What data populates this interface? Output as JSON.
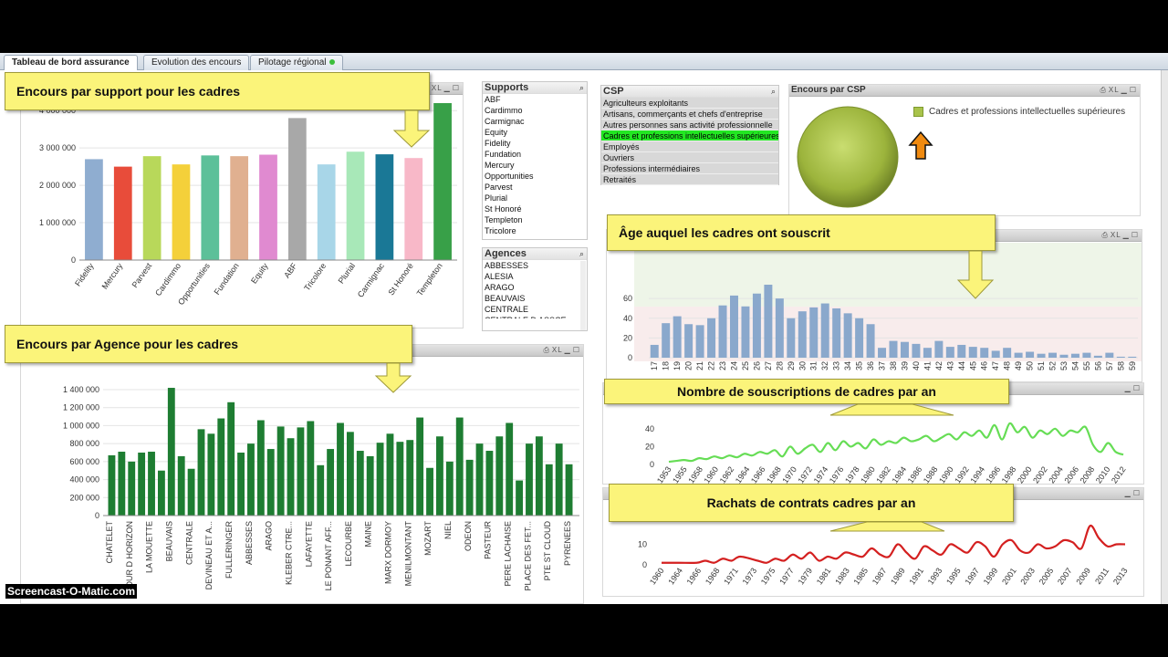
{
  "tabs": [
    {
      "label": "Tableau de bord assurance",
      "active": true
    },
    {
      "label": "Evolution des encours",
      "active": false
    },
    {
      "label": "Pilotage régional",
      "active": false
    }
  ],
  "callouts": {
    "support": "Encours par support pour les cadres",
    "agence": "Encours par Agence pour les cadres",
    "age": "Âge auquel les cadres ont souscrit",
    "souscriptions": "Nombre de souscriptions de cadres par an",
    "rachats": "Rachats de contrats cadres par an"
  },
  "panel_icons": {
    "xl": "XL"
  },
  "supports_list": {
    "title": "Supports",
    "items": [
      "ABF",
      "Cardimmo",
      "Carmignac",
      "Equity",
      "Fidelity",
      "Fundation",
      "Mercury",
      "Opportunities",
      "Parvest",
      "Plurial",
      "St Honoré",
      "Templeton",
      "Tricolore"
    ]
  },
  "agences_list": {
    "title": "Agences",
    "items": [
      "ABBESSES",
      "ALESIA",
      "ARAGO",
      "BEAUVAIS",
      "CENTRALE",
      "CENTRALE D ASSCE"
    ]
  },
  "csp_list": {
    "title": "CSP",
    "items": [
      "Agriculteurs exploitants",
      "Artisans, commerçants et chefs d'entreprise",
      "Autres personnes sans activité professionnelle",
      "Cadres et professions intellectuelles supérieures",
      "Employés",
      "Ouvriers",
      "Professions intermédiaires",
      "Retraités"
    ],
    "selected_index": 3
  },
  "encours_csp": {
    "title": "Encours par CSP",
    "legend": "Cadres et professions intellectuelles supérieures"
  },
  "watermark": "Screencast-O-Matic.com",
  "charts": {
    "support": {
      "type": "bar",
      "categories": [
        "Fidelity",
        "Mercury",
        "Parvest",
        "Cardimmo",
        "Opportunities",
        "Fundation",
        "Equity",
        "ABF",
        "Tricolore",
        "Plurial",
        "Carmignac",
        "St Honoré",
        "Templeton"
      ],
      "values": [
        2700000,
        2500000,
        2780000,
        2560000,
        2800000,
        2780000,
        2820000,
        3800000,
        2560000,
        2900000,
        2830000,
        2730000,
        4200000
      ],
      "colors": [
        "#8fadd0",
        "#e84c3a",
        "#b8d85a",
        "#f4d03a",
        "#5cc099",
        "#e0b090",
        "#e08ad0",
        "#a8a8a8",
        "#a8d6e8",
        "#a8e8b8",
        "#1a7896",
        "#f8b8c8",
        "#38a048"
      ],
      "ylim": [
        0,
        4200000
      ],
      "ticks": [
        0,
        1000000,
        2000000,
        3000000,
        4000000
      ],
      "tick_labels": [
        "0",
        "1 000 000",
        "2 000 000",
        "3 000 000",
        "4 000 000"
      ]
    },
    "agence": {
      "type": "bar",
      "color": "#1e7d32",
      "values": [
        670000,
        710000,
        600000,
        700000,
        710000,
        500000,
        1420000,
        660000,
        520000,
        960000,
        910000,
        1080000,
        1260000,
        700000,
        800000,
        1060000,
        740000,
        990000,
        860000,
        980000,
        1050000,
        560000,
        740000,
        1030000,
        930000,
        720000,
        660000,
        810000,
        910000,
        820000,
        840000,
        1090000,
        530000,
        880000,
        600000,
        1090000,
        620000,
        800000,
        720000,
        880000,
        1030000,
        390000,
        800000,
        880000,
        570000,
        800000,
        570000
      ],
      "labels": [
        "CHATELET",
        "COUR D HORIZON",
        "LA MOUETTE",
        "BEAUVAIS",
        "CENTRALE",
        "DEVINEAU ET A...",
        "FULLERINGER",
        "ABBESSES",
        "ARAGO",
        "KLEBER CTRE...",
        "LAFAYETTE",
        "LE PONANT AFF...",
        "LECOURBE",
        "MAINE",
        "MARX DORMOY",
        "MENILMONTANT",
        "MOZART",
        "NIEL",
        "ODEON",
        "PASTEUR",
        "PERE LACHAISE",
        "PLACE DES FET...",
        "PTE ST CLOUD",
        "PYRENEES"
      ],
      "ylim": [
        0,
        1400000
      ],
      "ticks": [
        0,
        200000,
        400000,
        600000,
        800000,
        1000000,
        1200000,
        1400000
      ],
      "tick_labels": [
        "0",
        "200 000",
        "400 000",
        "600 000",
        "800 000",
        "1 000 000",
        "1 200 000",
        "1 400 000"
      ]
    },
    "age": {
      "type": "bar",
      "color": "#8aa8cc",
      "categories": [
        "17",
        "18",
        "19",
        "20",
        "21",
        "22",
        "23",
        "24",
        "25",
        "26",
        "27",
        "28",
        "29",
        "30",
        "31",
        "32",
        "33",
        "34",
        "35",
        "36",
        "37",
        "38",
        "39",
        "40",
        "41",
        "42",
        "43",
        "44",
        "45",
        "46",
        "47",
        "48",
        "49",
        "50",
        "51",
        "52",
        "53",
        "54",
        "55",
        "56",
        "57",
        "58",
        "59"
      ],
      "values": [
        13,
        35,
        42,
        34,
        33,
        40,
        53,
        63,
        52,
        65,
        74,
        60,
        40,
        47,
        51,
        55,
        50,
        45,
        40,
        34,
        10,
        17,
        16,
        14,
        10,
        17,
        11,
        13,
        11,
        10,
        7,
        10,
        5,
        6,
        4,
        5,
        3,
        4,
        5,
        2,
        5,
        1,
        1
      ],
      "ylim": [
        0,
        74
      ],
      "ticks": [
        0,
        20,
        40,
        60
      ],
      "tick_labels": [
        "0",
        "20",
        "40",
        "60"
      ]
    },
    "souscriptions": {
      "type": "line",
      "color": "#66dd55",
      "years": [
        1953,
        1954,
        1955,
        1956,
        1957,
        1958,
        1959,
        1960,
        1961,
        1962,
        1963,
        1964,
        1965,
        1966,
        1967,
        1968,
        1969,
        1970,
        1971,
        1972,
        1973,
        1974,
        1975,
        1976,
        1977,
        1978,
        1979,
        1980,
        1981,
        1982,
        1983,
        1984,
        1985,
        1986,
        1987,
        1988,
        1989,
        1990,
        1991,
        1992,
        1993,
        1994,
        1995,
        1996,
        1997,
        1998,
        1999,
        2000,
        2001,
        2002,
        2003,
        2004,
        2005,
        2006,
        2007,
        2008,
        2009,
        2010,
        2011,
        2012,
        2013
      ],
      "values": [
        3,
        4,
        5,
        4,
        7,
        6,
        9,
        7,
        10,
        8,
        12,
        10,
        14,
        12,
        16,
        9,
        20,
        12,
        18,
        22,
        14,
        24,
        16,
        26,
        20,
        24,
        18,
        28,
        22,
        26,
        24,
        30,
        26,
        28,
        32,
        26,
        30,
        34,
        28,
        36,
        32,
        38,
        30,
        44,
        28,
        46,
        36,
        42,
        30,
        38,
        34,
        40,
        32,
        38,
        36,
        42,
        22,
        14,
        24,
        14,
        11
      ],
      "tick_labels": [
        "1953",
        "1955",
        "1958",
        "1960",
        "1962",
        "1964",
        "1966",
        "1968",
        "1970",
        "1972",
        "1974",
        "1976",
        "1978",
        "1980",
        "1982",
        "1984",
        "1986",
        "1988",
        "1990",
        "1992",
        "1994",
        "1996",
        "1998",
        "2000",
        "2002",
        "2004",
        "2006",
        "2008",
        "2010",
        "2012"
      ],
      "ylim": [
        0,
        48
      ],
      "ticks": [
        0,
        20,
        40
      ],
      "tick_labels_y": [
        "0",
        "20",
        "40"
      ]
    },
    "rachats": {
      "type": "line",
      "color": "#d42020",
      "years": [
        1960,
        1962,
        1964,
        1965,
        1966,
        1967,
        1968,
        1969,
        1971,
        1972,
        1973,
        1974,
        1975,
        1976,
        1977,
        1978,
        1979,
        1980,
        1981,
        1982,
        1983,
        1984,
        1985,
        1986,
        1987,
        1988,
        1989,
        1990,
        1991,
        1992,
        1993,
        1994,
        1995,
        1996,
        1997,
        1998,
        1999,
        2000,
        2001,
        2002,
        2003,
        2004,
        2005,
        2006,
        2007,
        2008,
        2009,
        2010,
        2011,
        2012,
        2013
      ],
      "values": [
        1,
        1,
        1,
        2,
        1,
        3,
        2,
        4,
        2,
        1,
        3,
        2,
        5,
        3,
        6,
        2,
        4,
        3,
        6,
        5,
        4,
        8,
        5,
        4,
        10,
        6,
        3,
        9,
        7,
        5,
        10,
        8,
        6,
        11,
        9,
        4,
        10,
        12,
        7,
        6,
        10,
        8,
        9,
        12,
        11,
        8,
        19,
        13,
        9,
        10,
        10
      ],
      "tick_labels": [
        "1960",
        "1964",
        "1966",
        "1968",
        "1971",
        "1973",
        "1975",
        "1977",
        "1979",
        "1981",
        "1983",
        "1985",
        "1987",
        "1989",
        "1991",
        "1993",
        "1995",
        "1997",
        "1999",
        "2001",
        "2003",
        "2005",
        "2007",
        "2009",
        "2011",
        "2013"
      ],
      "ylim": [
        0,
        20
      ],
      "ticks": [
        0,
        10
      ],
      "tick_labels_y": [
        "0",
        "10"
      ]
    }
  }
}
